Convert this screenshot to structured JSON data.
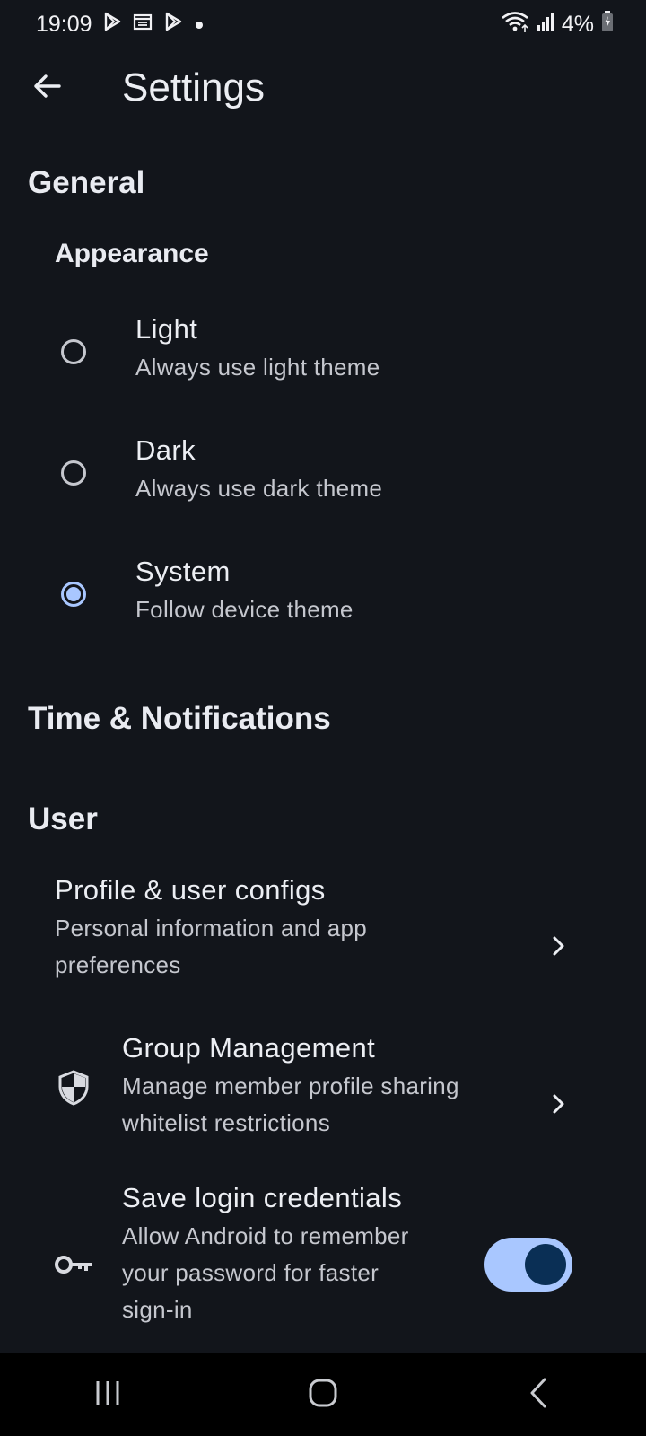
{
  "status_bar": {
    "time": "19:09",
    "battery_percent": "4%",
    "notification_icons": [
      "play-store-icon",
      "calendar-icon",
      "play-store-icon",
      "dot-icon"
    ],
    "system_icons": [
      "wifi-icon",
      "signal-icon",
      "battery-charging-icon"
    ]
  },
  "app_bar": {
    "title": "Settings",
    "back_icon": "arrow-left-icon"
  },
  "general": {
    "header": "General",
    "appearance": {
      "header": "Appearance",
      "options": [
        {
          "title": "Light",
          "subtitle": "Always use light theme",
          "selected": false
        },
        {
          "title": "Dark",
          "subtitle": "Always use dark theme",
          "selected": false
        },
        {
          "title": "System",
          "subtitle": "Follow device theme",
          "selected": true
        }
      ]
    }
  },
  "time_notifications": {
    "header": "Time & Notifications"
  },
  "user": {
    "header": "User",
    "profile": {
      "title": "Profile & user configs",
      "subtitle_line1": "Personal information and app",
      "subtitle_line2": "preferences"
    },
    "group_management": {
      "title": "Group Management",
      "subtitle_line1": "Manage member profile sharing",
      "subtitle_line2": "whitelist restrictions",
      "icon": "shield-icon"
    },
    "save_login": {
      "title": "Save login credentials",
      "subtitle_line1": "Allow Android to remember",
      "subtitle_line2": "your password for faster",
      "subtitle_line3": "sign-in",
      "icon": "key-icon",
      "enabled": true
    }
  },
  "colors": {
    "background": "#12151b",
    "accent": "#a9c7ff",
    "toggle_knob": "#0a2f55",
    "nav_bar": "#000000"
  },
  "nav_bar": {
    "buttons": [
      "recent-apps-icon",
      "home-icon",
      "back-icon"
    ]
  }
}
